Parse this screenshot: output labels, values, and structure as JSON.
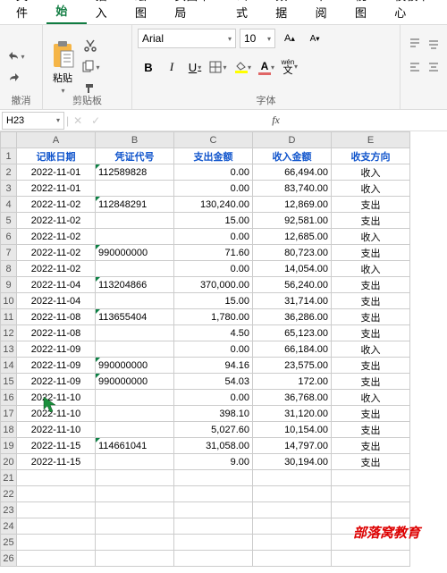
{
  "tabs": [
    "文件",
    "开始",
    "插入",
    "绘图",
    "页面布局",
    "公式",
    "数据",
    "审阅",
    "视图",
    "模板中心"
  ],
  "active_tab": 1,
  "ribbon": {
    "undo_label": "撤消",
    "clipboard_label": "剪贴板",
    "paste_label": "粘贴",
    "font_label": "字体",
    "font_name": "Arial",
    "font_size": "10",
    "bold": "B",
    "italic": "I",
    "underline": "U",
    "wen": "wén",
    "wen2": "文"
  },
  "namebox": "H23",
  "fx": "fx",
  "columns": [
    "A",
    "B",
    "C",
    "D",
    "E"
  ],
  "headers": [
    "记账日期",
    "凭证代号",
    "支出金额",
    "收入金额",
    "收支方向"
  ],
  "rows": [
    {
      "n": 1
    },
    {
      "n": 2,
      "d": "2022-11-01",
      "v": "112589828",
      "out": "0.00",
      "in": "66,494.00",
      "dir": "收入"
    },
    {
      "n": 3,
      "d": "2022-11-01",
      "v": "",
      "out": "0.00",
      "in": "83,740.00",
      "dir": "收入"
    },
    {
      "n": 4,
      "d": "2022-11-02",
      "v": "112848291",
      "out": "130,240.00",
      "in": "12,869.00",
      "dir": "支出"
    },
    {
      "n": 5,
      "d": "2022-11-02",
      "v": "",
      "out": "15.00",
      "in": "92,581.00",
      "dir": "支出"
    },
    {
      "n": 6,
      "d": "2022-11-02",
      "v": "",
      "out": "0.00",
      "in": "12,685.00",
      "dir": "收入"
    },
    {
      "n": 7,
      "d": "2022-11-02",
      "v": "990000000",
      "out": "71.60",
      "in": "80,723.00",
      "dir": "支出"
    },
    {
      "n": 8,
      "d": "2022-11-02",
      "v": "",
      "out": "0.00",
      "in": "14,054.00",
      "dir": "收入"
    },
    {
      "n": 9,
      "d": "2022-11-04",
      "v": "113204866",
      "out": "370,000.00",
      "in": "56,240.00",
      "dir": "支出"
    },
    {
      "n": 10,
      "d": "2022-11-04",
      "v": "",
      "out": "15.00",
      "in": "31,714.00",
      "dir": "支出"
    },
    {
      "n": 11,
      "d": "2022-11-08",
      "v": "113655404",
      "out": "1,780.00",
      "in": "36,286.00",
      "dir": "支出"
    },
    {
      "n": 12,
      "d": "2022-11-08",
      "v": "",
      "out": "4.50",
      "in": "65,123.00",
      "dir": "支出"
    },
    {
      "n": 13,
      "d": "2022-11-09",
      "v": "",
      "out": "0.00",
      "in": "66,184.00",
      "dir": "收入"
    },
    {
      "n": 14,
      "d": "2022-11-09",
      "v": "990000000",
      "out": "94.16",
      "in": "23,575.00",
      "dir": "支出"
    },
    {
      "n": 15,
      "d": "2022-11-09",
      "v": "990000000",
      "out": "54.03",
      "in": "172.00",
      "dir": "支出"
    },
    {
      "n": 16,
      "d": "2022-11-10",
      "v": "",
      "out": "0.00",
      "in": "36,768.00",
      "dir": "收入"
    },
    {
      "n": 17,
      "d": "2022-11-10",
      "v": "",
      "out": "398.10",
      "in": "31,120.00",
      "dir": "支出"
    },
    {
      "n": 18,
      "d": "2022-11-10",
      "v": "",
      "out": "5,027.60",
      "in": "10,154.00",
      "dir": "支出"
    },
    {
      "n": 19,
      "d": "2022-11-15",
      "v": "114661041",
      "out": "31,058.00",
      "in": "14,797.00",
      "dir": "支出"
    },
    {
      "n": 20,
      "d": "2022-11-15",
      "v": "",
      "out": "9.00",
      "in": "30,194.00",
      "dir": "支出"
    },
    {
      "n": 21
    },
    {
      "n": 22
    },
    {
      "n": 23
    },
    {
      "n": 24
    },
    {
      "n": 25
    },
    {
      "n": 26
    }
  ],
  "watermark": "部落窝教育"
}
